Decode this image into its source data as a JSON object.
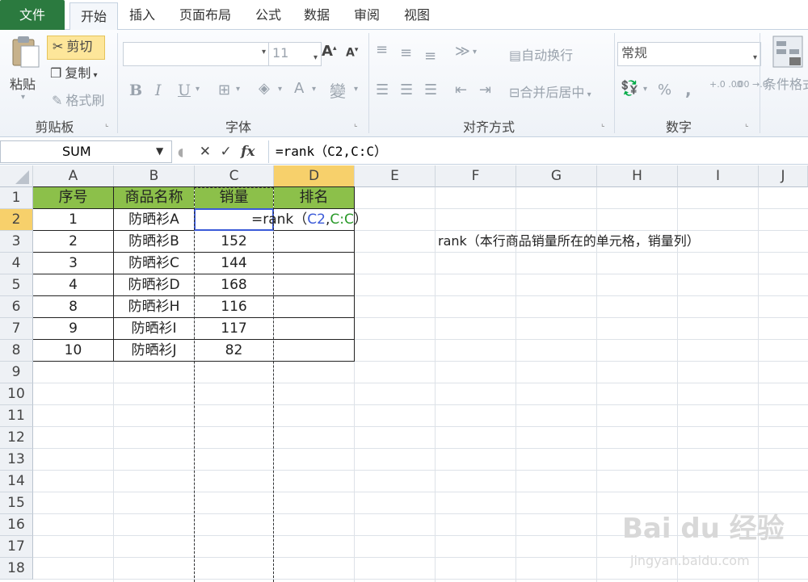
{
  "menu": {
    "tabs": [
      "文件",
      "开始",
      "插入",
      "页面布局",
      "公式",
      "数据",
      "审阅",
      "视图"
    ]
  },
  "ribbon": {
    "clipboard": {
      "paste": "粘贴",
      "cut": "剪切",
      "copy": "复制",
      "format_painter": "格式刷",
      "group": "剪贴板"
    },
    "font": {
      "name": "",
      "size": "11",
      "bold": "B",
      "italic": "I",
      "underline": "U",
      "grow": "A",
      "shrink": "A",
      "font_color": "A",
      "phonetic": "wén",
      "group": "字体"
    },
    "alignment": {
      "wrap": "自动换行",
      "merge": "合并后居中",
      "group": "对齐方式"
    },
    "number": {
      "format": "常规",
      "percent": "%",
      "comma": ",",
      "inc": "+.0 .00",
      "dec": ".00 →.0",
      "group": "数字"
    },
    "styles": {
      "conditional": "条件格式"
    }
  },
  "formula_bar": {
    "name_box": "SUM",
    "formula": "=rank（C2,C:C）",
    "fx": "fx"
  },
  "sheet": {
    "columns": [
      "A",
      "B",
      "C",
      "D",
      "E",
      "F",
      "G",
      "H",
      "I",
      "J"
    ],
    "rows": [
      "1",
      "2",
      "3",
      "4",
      "5",
      "6",
      "7",
      "8",
      "9",
      "10",
      "11",
      "12",
      "13",
      "14",
      "15",
      "16",
      "17",
      "18"
    ],
    "headers": {
      "a": "序号",
      "b": "商品名称",
      "c": "销量",
      "d": "排名"
    },
    "data": [
      {
        "a": "1",
        "b": "防晒衫A",
        "c": ""
      },
      {
        "a": "2",
        "b": "防晒衫B",
        "c": "152"
      },
      {
        "a": "3",
        "b": "防晒衫C",
        "c": "144"
      },
      {
        "a": "4",
        "b": "防晒衫D",
        "c": "168"
      },
      {
        "a": "8",
        "b": "防晒衫H",
        "c": "116"
      },
      {
        "a": "9",
        "b": "防晒衫I",
        "c": "117"
      },
      {
        "a": "10",
        "b": "防晒衫J",
        "c": "82"
      }
    ],
    "edit": {
      "prefix": "=rank（",
      "ref1": "C2",
      "sep": ",",
      "ref2": "C:C",
      "suffix": "）"
    },
    "note": "rank（本行商品销量所在的单元格，销量列）"
  },
  "watermark": {
    "brand": "Bai du 经验",
    "url": "jingyan.baidu.com"
  },
  "colors": {
    "header_fill": "#8cc04a",
    "file_tab": "#2b7a3f",
    "ref1": "#3b5ad8",
    "ref2": "#2a9a2a"
  }
}
